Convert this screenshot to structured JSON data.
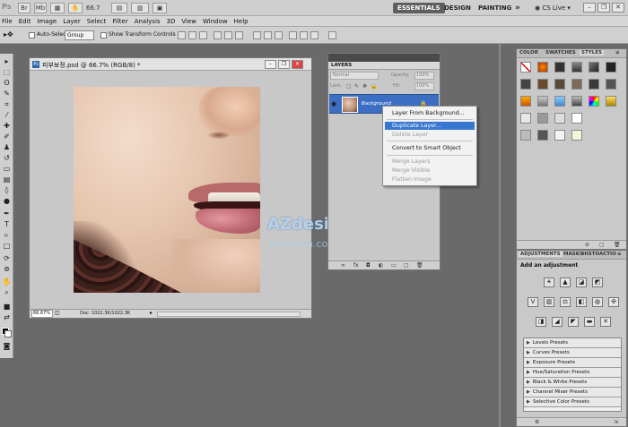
{
  "titlebar": {
    "zoom": "66.7",
    "workspaces": [
      "ESSENTIALS",
      "DESIGN",
      "PAINTING"
    ],
    "more": "»",
    "cs_live": "CS Live"
  },
  "menu": [
    "File",
    "Edit",
    "Image",
    "Layer",
    "Select",
    "Filter",
    "Analysis",
    "3D",
    "View",
    "Window",
    "Help"
  ],
  "options": {
    "auto_select_label": "Auto-Select:",
    "auto_select_value": "Group",
    "transform_label": "Show Transform Controls"
  },
  "document": {
    "title": "피부보정.psd @ 66.7% (RGB/8) *",
    "zoom": "66.67%",
    "doc_info": "Doc: 1022.3K/1022.3K"
  },
  "watermark": {
    "brand": "AZdesign™",
    "url": "azdesign.com"
  },
  "layers_panel": {
    "tab": "LAYERS",
    "blend_mode": "Normal",
    "opacity_label": "Opacity:",
    "opacity_value": "100%",
    "lock_label": "Lock:",
    "fill_label": "Fill:",
    "fill_value": "100%",
    "layer_name": "Background"
  },
  "context_menu": {
    "items": [
      {
        "label": "Layer From Background...",
        "state": "normal"
      },
      {
        "label": "Duplicate Layer...",
        "state": "selected"
      },
      {
        "label": "Delete Layer",
        "state": "disabled"
      },
      {
        "label": "Convert to Smart Object",
        "state": "normal"
      },
      {
        "label": "Merge Layers",
        "state": "disabled"
      },
      {
        "label": "Merge Visible",
        "state": "disabled"
      },
      {
        "label": "Flatten Image",
        "state": "disabled"
      }
    ]
  },
  "styles_panel": {
    "tabs": [
      "COLOR",
      "SWATCHES",
      "STYLES"
    ],
    "active_tab": "STYLES"
  },
  "adjustments_panel": {
    "tabs": [
      "ADJUSTMENTS",
      "MASKS",
      "HISTO",
      "ACTIO"
    ],
    "heading": "Add an adjustment",
    "presets": [
      "Levels Presets",
      "Curves Presets",
      "Exposure Presets",
      "Hue/Saturation Presets",
      "Black & White Presets",
      "Channel Mixer Presets",
      "Selective Color Presets"
    ]
  },
  "colors": {
    "selected": "#3877d1",
    "active_workspace": "#5f5f5f",
    "layer_selected": "#3c6fc4"
  }
}
